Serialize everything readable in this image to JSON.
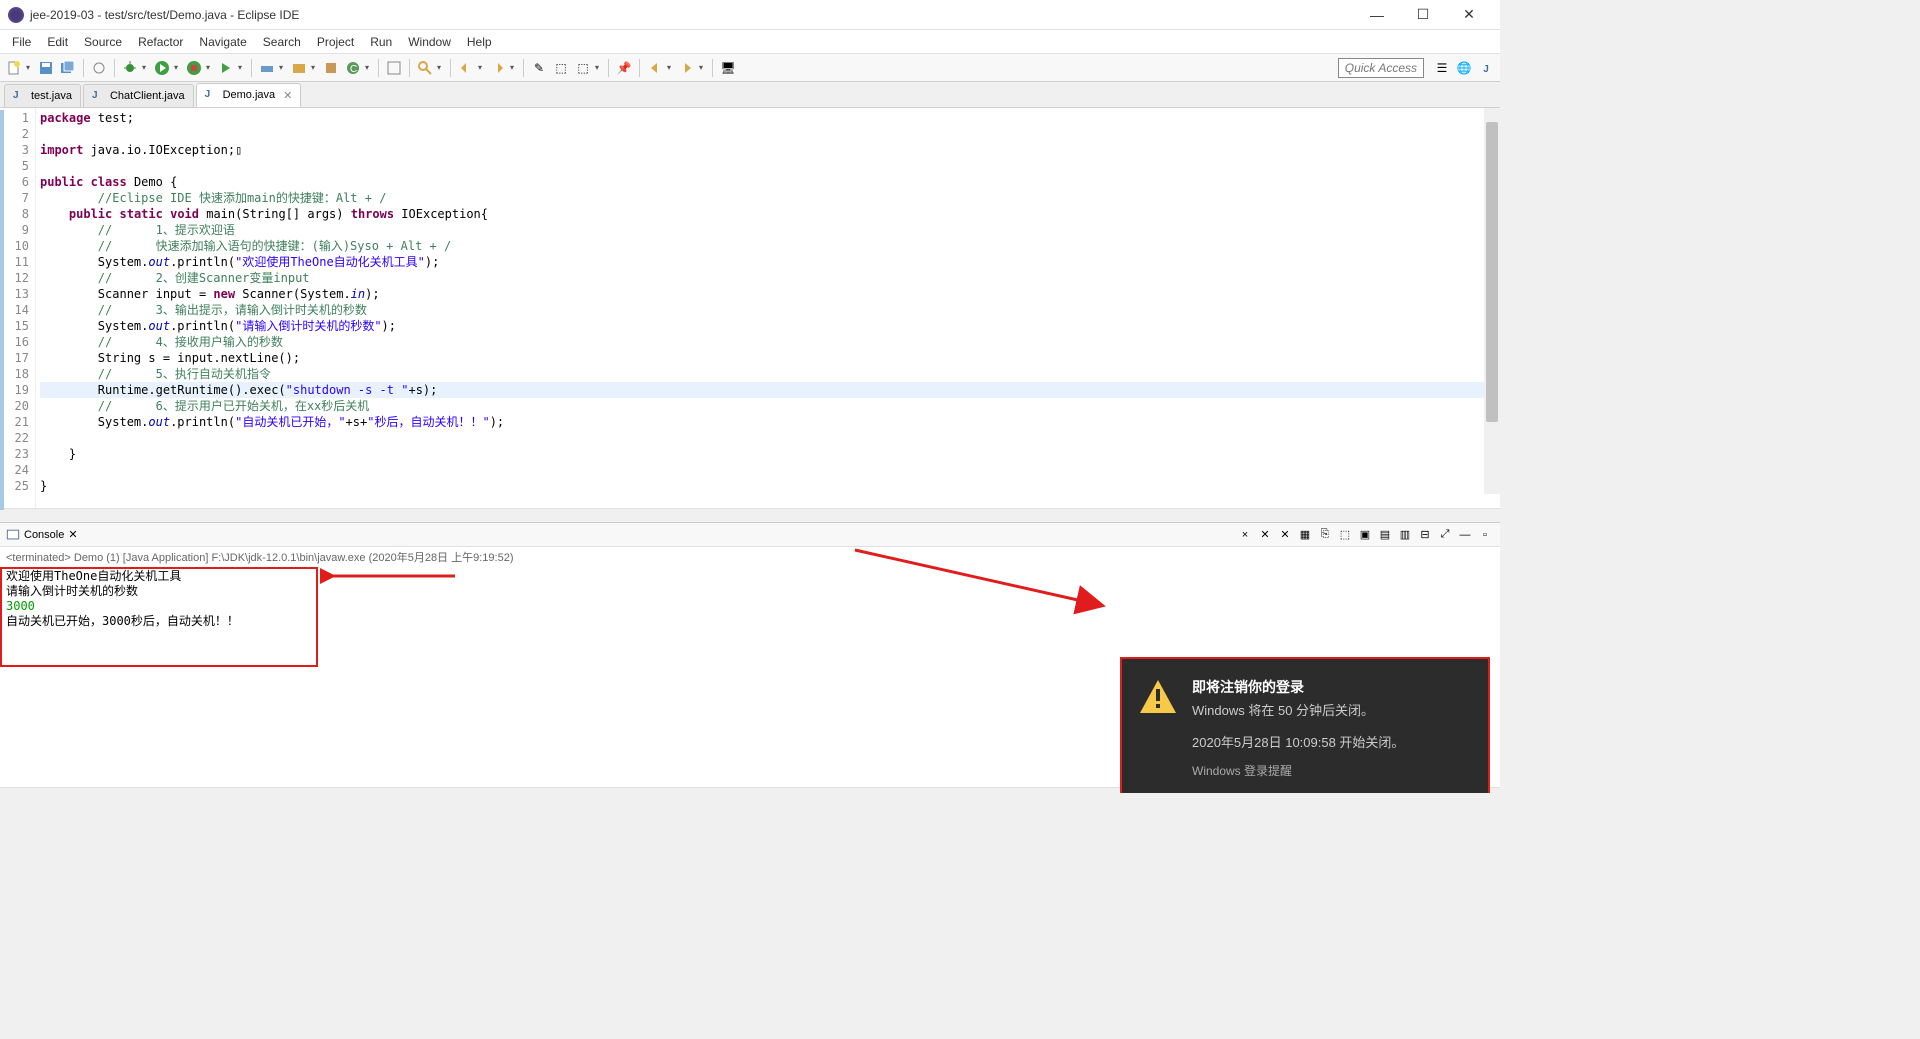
{
  "window": {
    "title": "jee-2019-03 - test/src/test/Demo.java - Eclipse IDE"
  },
  "menu": {
    "items": [
      "File",
      "Edit",
      "Source",
      "Refactor",
      "Navigate",
      "Search",
      "Project",
      "Run",
      "Window",
      "Help"
    ]
  },
  "toolbar": {
    "quick_access": "Quick Access"
  },
  "tabs": {
    "items": [
      {
        "label": "test.java",
        "active": false
      },
      {
        "label": "ChatClient.java",
        "active": false
      },
      {
        "label": "Demo.java",
        "active": true
      }
    ]
  },
  "code": {
    "lines": [
      {
        "n": "1",
        "tokens": [
          {
            "t": "package",
            "c": "kw"
          },
          {
            "t": " test;",
            "c": ""
          }
        ]
      },
      {
        "n": "2",
        "tokens": []
      },
      {
        "n": "3",
        "marker": "⊕",
        "tokens": [
          {
            "t": "import",
            "c": "kw"
          },
          {
            "t": " java.io.IOException;",
            "c": ""
          },
          {
            "t": "▯",
            "c": ""
          }
        ]
      },
      {
        "n": "5",
        "tokens": []
      },
      {
        "n": "6",
        "tokens": [
          {
            "t": "public",
            "c": "kw"
          },
          {
            "t": " ",
            "c": ""
          },
          {
            "t": "class",
            "c": "kw"
          },
          {
            "t": " Demo {",
            "c": ""
          }
        ]
      },
      {
        "n": "7",
        "tokens": [
          {
            "t": "        ",
            "c": ""
          },
          {
            "t": "//Eclipse IDE 快速添加main的快捷键：Alt + /",
            "c": "cmt"
          }
        ]
      },
      {
        "n": "8",
        "marker": "⊖",
        "tokens": [
          {
            "t": "    ",
            "c": ""
          },
          {
            "t": "public",
            "c": "kw"
          },
          {
            "t": " ",
            "c": ""
          },
          {
            "t": "static",
            "c": "kw"
          },
          {
            "t": " ",
            "c": ""
          },
          {
            "t": "void",
            "c": "kw"
          },
          {
            "t": " main(String[] args) ",
            "c": ""
          },
          {
            "t": "throws",
            "c": "kw"
          },
          {
            "t": " IOException{",
            "c": ""
          }
        ]
      },
      {
        "n": "9",
        "tokens": [
          {
            "t": "        ",
            "c": ""
          },
          {
            "t": "//      1、提示欢迎语",
            "c": "cmt"
          }
        ]
      },
      {
        "n": "10",
        "tokens": [
          {
            "t": "        ",
            "c": ""
          },
          {
            "t": "//      快速添加输入语句的快捷键：(输入)Syso + Alt + /",
            "c": "cmt"
          }
        ]
      },
      {
        "n": "11",
        "tokens": [
          {
            "t": "        System.",
            "c": ""
          },
          {
            "t": "out",
            "c": "field-static"
          },
          {
            "t": ".println(",
            "c": ""
          },
          {
            "t": "\"欢迎使用TheOne自动化关机工具\"",
            "c": "str"
          },
          {
            "t": ");",
            "c": ""
          }
        ]
      },
      {
        "n": "12",
        "tokens": [
          {
            "t": "        ",
            "c": ""
          },
          {
            "t": "//      2、创建Scanner变量input",
            "c": "cmt"
          }
        ]
      },
      {
        "n": "13",
        "tokens": [
          {
            "t": "        Scanner input = ",
            "c": ""
          },
          {
            "t": "new",
            "c": "kw"
          },
          {
            "t": " Scanner(System.",
            "c": ""
          },
          {
            "t": "in",
            "c": "field-static"
          },
          {
            "t": ");",
            "c": ""
          }
        ]
      },
      {
        "n": "14",
        "tokens": [
          {
            "t": "        ",
            "c": ""
          },
          {
            "t": "//      3、输出提示，请输入倒计时关机的秒数",
            "c": "cmt"
          }
        ]
      },
      {
        "n": "15",
        "tokens": [
          {
            "t": "        System.",
            "c": ""
          },
          {
            "t": "out",
            "c": "field-static"
          },
          {
            "t": ".println(",
            "c": ""
          },
          {
            "t": "\"请输入倒计时关机的秒数\"",
            "c": "str"
          },
          {
            "t": ");",
            "c": ""
          }
        ]
      },
      {
        "n": "16",
        "tokens": [
          {
            "t": "        ",
            "c": ""
          },
          {
            "t": "//      4、接收用户输入的秒数",
            "c": "cmt"
          }
        ]
      },
      {
        "n": "17",
        "tokens": [
          {
            "t": "        String s = input.nextLine();",
            "c": ""
          }
        ]
      },
      {
        "n": "18",
        "tokens": [
          {
            "t": "        ",
            "c": ""
          },
          {
            "t": "//      5、执行自动关机指令",
            "c": "cmt"
          }
        ]
      },
      {
        "n": "19",
        "hl": true,
        "tokens": [
          {
            "t": "        Runtime.",
            "c": ""
          },
          {
            "t": "getRuntime",
            "c": "meth"
          },
          {
            "t": "().exec(",
            "c": ""
          },
          {
            "t": "\"shutdown -s -t \"",
            "c": "str"
          },
          {
            "t": "+s);",
            "c": ""
          }
        ]
      },
      {
        "n": "20",
        "tokens": [
          {
            "t": "        ",
            "c": ""
          },
          {
            "t": "//      6、提示用户已开始关机，在xx秒后关机",
            "c": "cmt"
          }
        ]
      },
      {
        "n": "21",
        "tokens": [
          {
            "t": "        System.",
            "c": ""
          },
          {
            "t": "out",
            "c": "field-static"
          },
          {
            "t": ".println(",
            "c": ""
          },
          {
            "t": "\"自动关机已开始，\"",
            "c": "str"
          },
          {
            "t": "+s+",
            "c": ""
          },
          {
            "t": "\"秒后，自动关机！！\"",
            "c": "str"
          },
          {
            "t": ");",
            "c": ""
          }
        ]
      },
      {
        "n": "22",
        "tokens": []
      },
      {
        "n": "23",
        "tokens": [
          {
            "t": "    }",
            "c": ""
          }
        ]
      },
      {
        "n": "24",
        "tokens": []
      },
      {
        "n": "25",
        "tokens": [
          {
            "t": "}",
            "c": ""
          }
        ]
      }
    ]
  },
  "console": {
    "title": "Console",
    "subheader": "<terminated> Demo (1) [Java Application] F:\\JDK\\jdk-12.0.1\\bin\\javaw.exe (2020年5月28日 上午9:19:52)",
    "output": [
      {
        "text": "欢迎使用TheOne自动化关机工具",
        "cls": ""
      },
      {
        "text": "请输入倒计时关机的秒数",
        "cls": ""
      },
      {
        "text": "3000",
        "cls": "input-line"
      },
      {
        "text": "自动关机已开始，3000秒后，自动关机！！",
        "cls": ""
      }
    ],
    "tools": [
      "×",
      "✕",
      "✕",
      "▦",
      "⎘",
      "⬚",
      "▣",
      "▤",
      "▥",
      "⊟",
      "⤢",
      "—",
      "▫"
    ]
  },
  "notification": {
    "title": "即将注销你的登录",
    "line1": "Windows 将在 50 分钟后关闭。",
    "line2": "2020年5月28日 10:09:58 开始关闭。",
    "footer": "Windows 登录提醒"
  }
}
